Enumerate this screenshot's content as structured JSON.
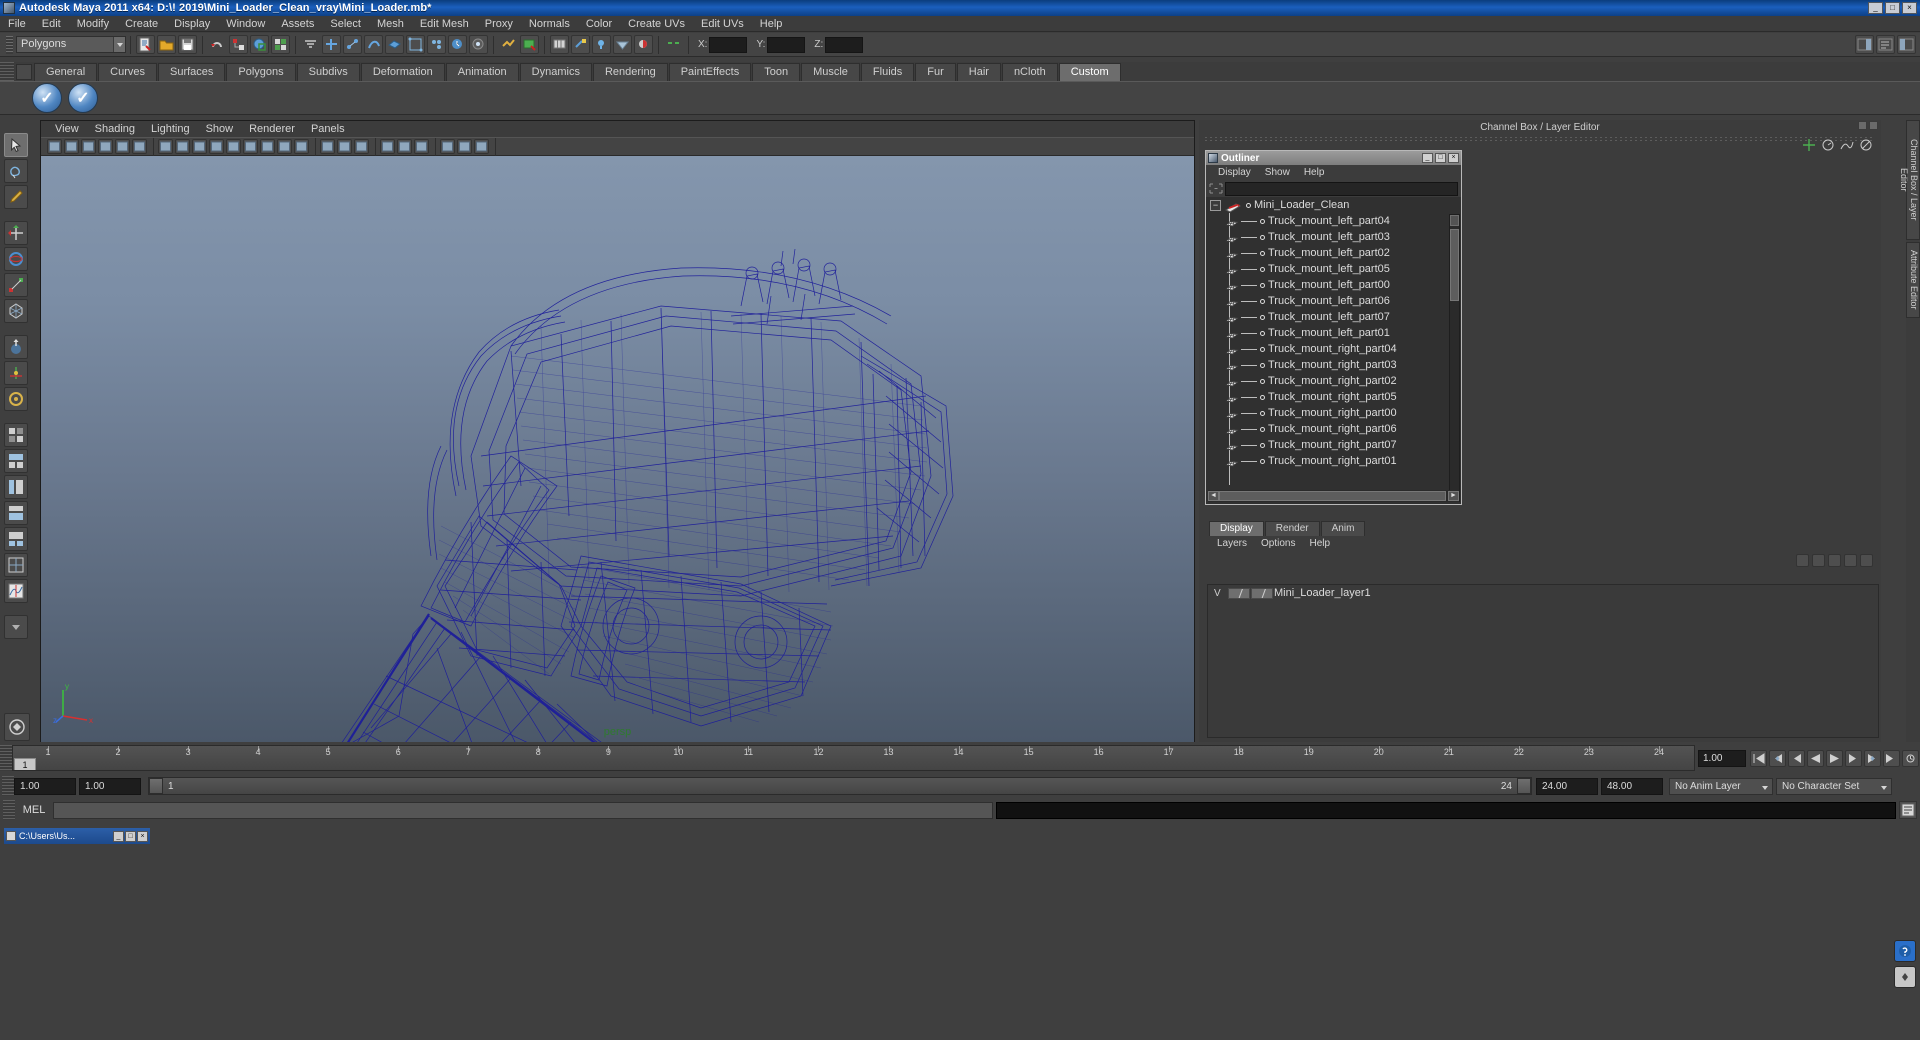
{
  "window": {
    "title": "Autodesk Maya 2011 x64: D:\\! 2019\\Mini_Loader_Clean_vray\\Mini_Loader.mb*",
    "icon": "maya-icon",
    "buttons": [
      "_",
      "□",
      "×"
    ]
  },
  "menu": {
    "items": [
      "File",
      "Edit",
      "Modify",
      "Create",
      "Display",
      "Window",
      "Assets",
      "Select",
      "Mesh",
      "Edit Mesh",
      "Proxy",
      "Normals",
      "Color",
      "Create UVs",
      "Edit UVs",
      "Help"
    ]
  },
  "statusbar": {
    "selection_mode": "Polygons",
    "axis_labels": [
      "X:",
      "Y:",
      "Z:"
    ],
    "field_values": [
      "",
      "",
      ""
    ]
  },
  "shelf": {
    "tabs": [
      "General",
      "Curves",
      "Surfaces",
      "Polygons",
      "Subdivs",
      "Deformation",
      "Animation",
      "Dynamics",
      "Rendering",
      "PaintEffects",
      "Toon",
      "Muscle",
      "Fluids",
      "Fur",
      "Hair",
      "nCloth",
      "Custom"
    ],
    "active_tab": "Custom",
    "buttons": [
      "vray-check-icon-1",
      "vray-check-icon-2"
    ]
  },
  "viewport": {
    "menu": [
      "View",
      "Shading",
      "Lighting",
      "Show",
      "Renderer",
      "Panels"
    ],
    "camera_label": "persp",
    "axis": {
      "x": "x",
      "y": "y",
      "z": "z"
    },
    "wireframe_color": "#1f1f9e",
    "bg_top": "#8496ad",
    "bg_bottom": "#4b5869"
  },
  "rightdock": {
    "header": "Channel Box / Layer Editor",
    "vtabs": [
      "Channel Box / Layer Editor",
      "Attribute Editor"
    ]
  },
  "outliner": {
    "title": "Outliner",
    "window_buttons": [
      "_",
      "□",
      "×"
    ],
    "menu": [
      "Display",
      "Show",
      "Help"
    ],
    "search_value": "",
    "search_placeholder": "",
    "root": "Mini_Loader_Clean",
    "items": [
      "Truck_mount_left_part04",
      "Truck_mount_left_part03",
      "Truck_mount_left_part02",
      "Truck_mount_left_part05",
      "Truck_mount_left_part00",
      "Truck_mount_left_part06",
      "Truck_mount_left_part07",
      "Truck_mount_left_part01",
      "Truck_mount_right_part04",
      "Truck_mount_right_part03",
      "Truck_mount_right_part02",
      "Truck_mount_right_part05",
      "Truck_mount_right_part00",
      "Truck_mount_right_part06",
      "Truck_mount_right_part07",
      "Truck_mount_right_part01"
    ]
  },
  "layereditor": {
    "tabs": [
      "Display",
      "Render",
      "Anim"
    ],
    "active_tab": "Display",
    "menu": [
      "Layers",
      "Options",
      "Help"
    ],
    "layers": [
      {
        "visibility": "V",
        "name": "Mini_Loader_layer1"
      }
    ]
  },
  "timeline": {
    "ticks": [
      "1",
      "2",
      "3",
      "4",
      "5",
      "6",
      "7",
      "8",
      "9",
      "10",
      "11",
      "12",
      "13",
      "14",
      "15",
      "16",
      "17",
      "18",
      "19",
      "20",
      "21",
      "22",
      "23",
      "24"
    ],
    "current_frame": "1",
    "current_time": "1.00",
    "transport": [
      "go-to-start",
      "step-back-key",
      "step-back",
      "play-backwards",
      "play-forwards",
      "step-forward",
      "step-forward-key",
      "go-to-end"
    ]
  },
  "rangeslider": {
    "start": "1.00",
    "end": "1.00",
    "range_start": "1",
    "range_end": "24",
    "playback_end": "24.00",
    "anim_end": "48.00",
    "anim_layer": "No Anim Layer",
    "character_set": "No Character Set"
  },
  "commandline": {
    "label": "MEL",
    "input_value": "",
    "output_value": ""
  },
  "taskbar": {
    "window_title": "C:\\Users\\Us...",
    "buttons": [
      "_",
      "□",
      "×"
    ]
  }
}
